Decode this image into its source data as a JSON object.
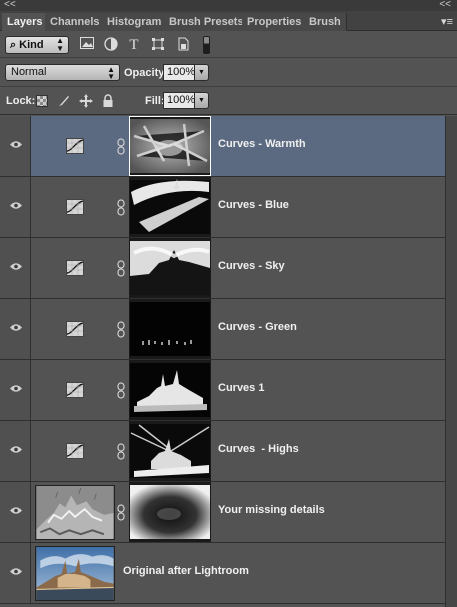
{
  "panel": {
    "collapse_left": "<<",
    "collapse_right": "<<",
    "menu_icon": "panel-menu-icon"
  },
  "tabs": [
    {
      "label": "Layers",
      "active": true
    },
    {
      "label": "Channels",
      "active": false
    },
    {
      "label": "Histogram",
      "active": false
    },
    {
      "label": "Brush Presets",
      "active": false
    },
    {
      "label": "Properties",
      "active": false
    },
    {
      "label": "Brush",
      "active": false
    }
  ],
  "filter": {
    "kind_label": "Kind",
    "icons": [
      "pixel-layer-filter-icon",
      "adjustment-layer-filter-icon",
      "type-layer-filter-icon",
      "shape-layer-filter-icon",
      "smart-object-filter-icon"
    ]
  },
  "blend": {
    "mode": "Normal",
    "opacity_label": "Opacity:",
    "opacity_value": "100%",
    "fill_label": "Fill:",
    "fill_value": "100%",
    "lock_label": "Lock:"
  },
  "layers": [
    {
      "name": "Curves - Warmth",
      "type": "curves",
      "selected": true
    },
    {
      "name": "Curves - Blue",
      "type": "curves",
      "selected": false
    },
    {
      "name": "Curves - Sky",
      "type": "curves",
      "selected": false
    },
    {
      "name": "Curves - Green",
      "type": "curves",
      "selected": false
    },
    {
      "name": "Curves 1",
      "type": "curves",
      "selected": false
    },
    {
      "name": "Curves  - Highs",
      "type": "curves",
      "selected": false
    },
    {
      "name": "Your missing details",
      "type": "pixel-with-mask",
      "selected": false
    },
    {
      "name": "Original after Lightroom",
      "type": "pixel",
      "selected": false
    }
  ],
  "colors": {
    "panel_bg": "#535353",
    "selected_row": "#5b6a80"
  }
}
